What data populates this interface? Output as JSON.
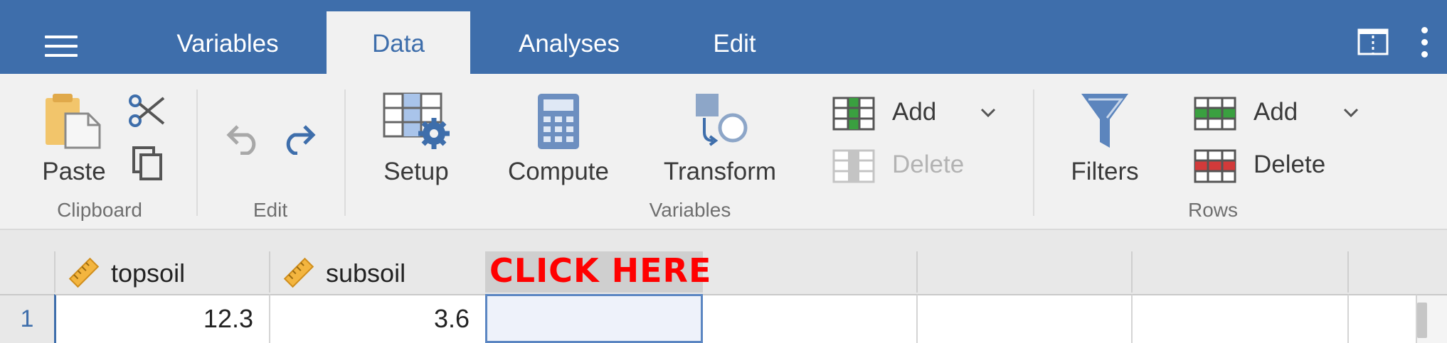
{
  "tabs": [
    "Variables",
    "Data",
    "Analyses",
    "Edit"
  ],
  "active_tab": "Data",
  "ribbon": {
    "clipboard": {
      "paste": "Paste",
      "group": "Clipboard"
    },
    "edit": {
      "group": "Edit"
    },
    "variables": {
      "setup": "Setup",
      "compute": "Compute",
      "transform": "Transform",
      "add": "Add",
      "delete": "Delete",
      "group": "Variables"
    },
    "rows": {
      "filters": "Filters",
      "add": "Add",
      "delete": "Delete",
      "group": "Rows"
    }
  },
  "columns": [
    {
      "name": "topsoil",
      "type_icon": "ruler-icon"
    },
    {
      "name": "subsoil",
      "type_icon": "ruler-icon"
    }
  ],
  "rows": [
    {
      "num": "1",
      "values": [
        "12.3",
        "3.6"
      ]
    }
  ],
  "overlay_text": "CLICK HERE",
  "colors": {
    "accent": "#3e6eab",
    "overlay": "#ff0000",
    "selected_cell": "#eef2fa"
  }
}
